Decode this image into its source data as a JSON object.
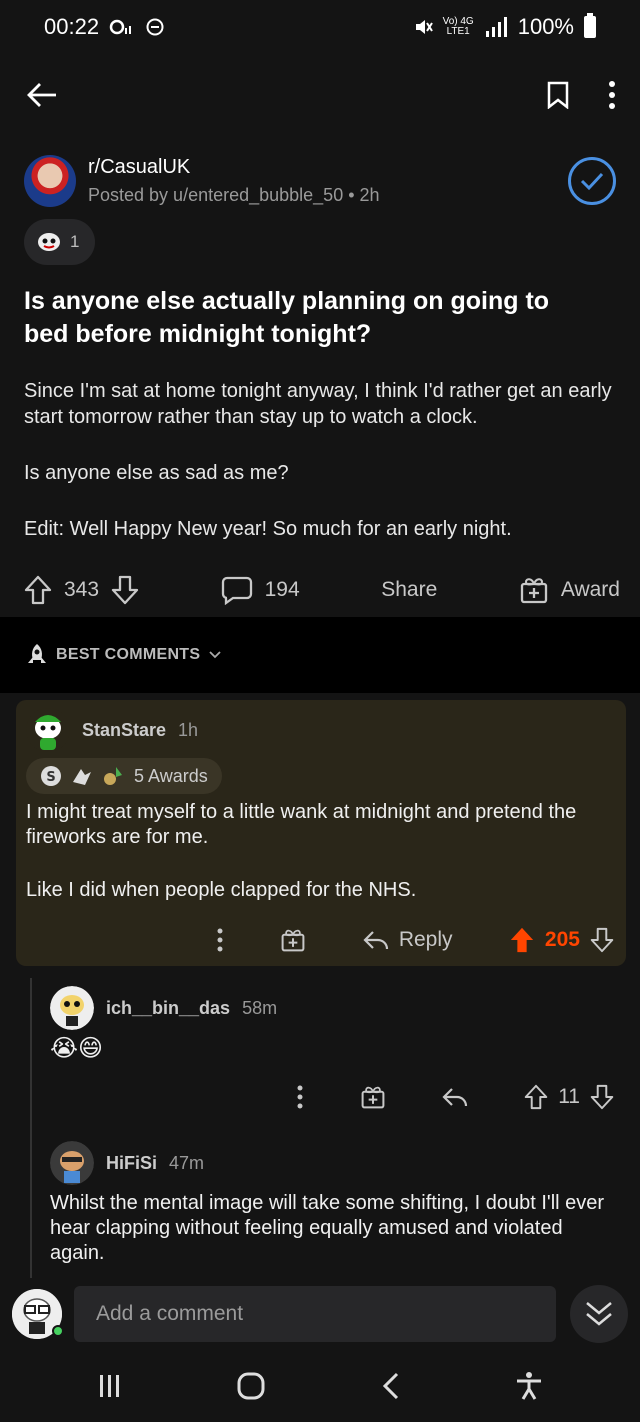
{
  "status_bar": {
    "time": "00:22",
    "network_label": "Vo) 4G",
    "network_sub": "LTE1",
    "battery": "100%"
  },
  "post": {
    "subreddit": "r/CasualUK",
    "posted_by": "Posted by u/entered_bubble_50 • 2h",
    "award_count": "1",
    "title": "Is anyone else actually planning on going to bed before midnight tonight?",
    "body": [
      "Since I'm sat at home tonight anyway, I think I'd rather get an early start tomorrow rather than stay up to watch a clock.",
      "Is anyone else as sad as me?",
      "Edit: Well Happy New year! So much for an early night."
    ],
    "score": "343",
    "comments": "194",
    "share_label": "Share",
    "award_label": "Award"
  },
  "sort": {
    "label": "BEST COMMENTS"
  },
  "comments": [
    {
      "user": "StanStare",
      "time": "1h",
      "awards": "5 Awards",
      "body": [
        "I might treat myself to a little wank at midnight and pretend the fireworks are for me.",
        "Like I did when people clapped for the NHS."
      ],
      "reply_label": "Reply",
      "score": "205"
    },
    {
      "user": "ich__bin__das",
      "time": "58m",
      "body": "😭😄",
      "score": "11"
    },
    {
      "user": "HiFiSi",
      "time": "47m",
      "body": "Whilst the mental image will take some shifting, I doubt I'll ever hear clapping without feeling equally amused and violated again."
    }
  ],
  "composer": {
    "placeholder": "Add a comment"
  },
  "colors": {
    "background": "#141414",
    "upvote_active": "#ff4500",
    "highlight_comment": "#2a2619",
    "join_blue": "#4a90e2"
  }
}
